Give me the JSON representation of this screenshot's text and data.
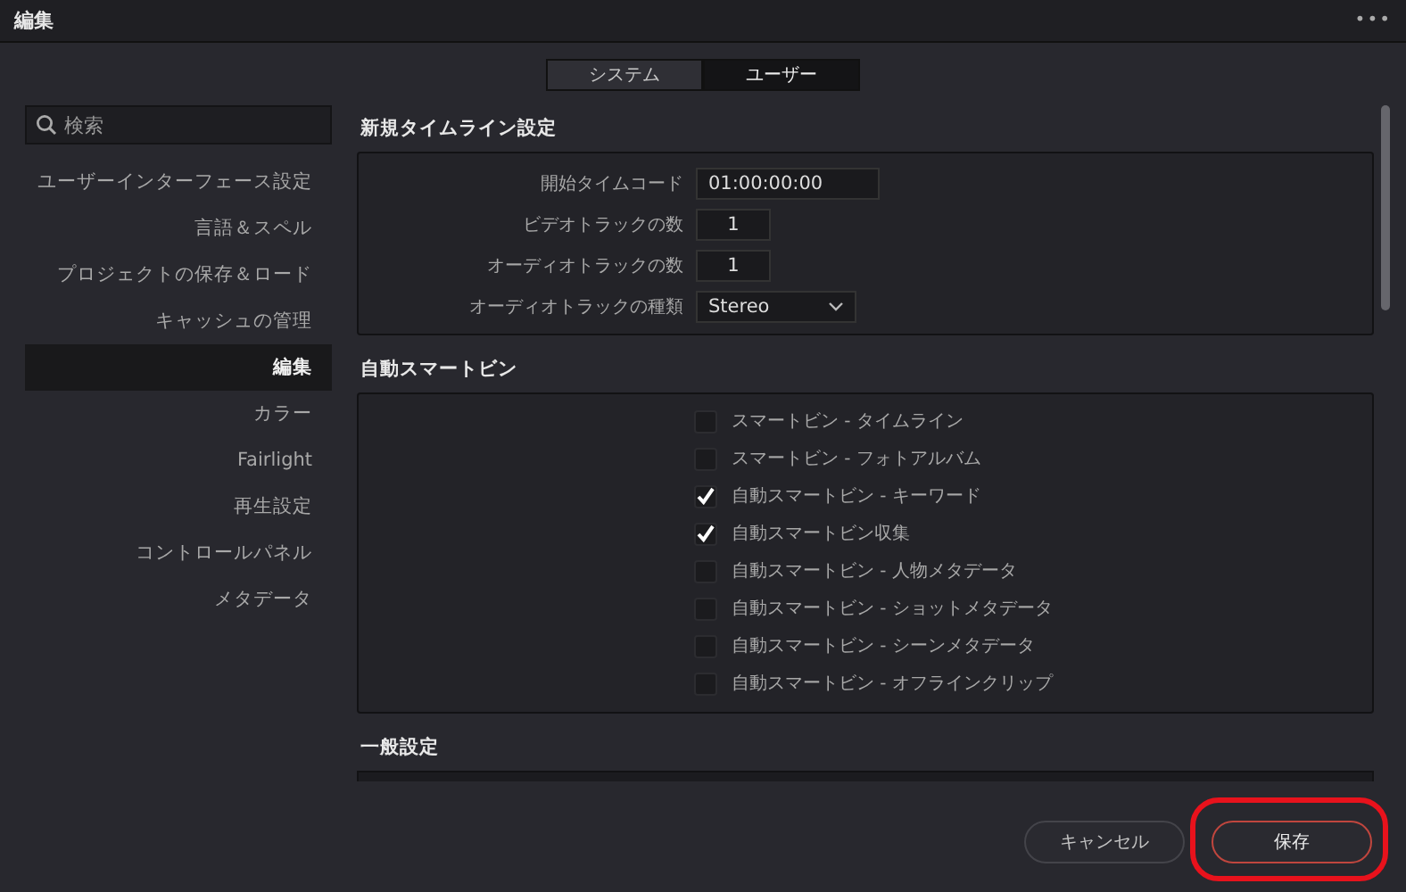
{
  "window": {
    "title": "編集",
    "menu_icon": "•••"
  },
  "tabs": [
    {
      "label": "システム",
      "selected": false
    },
    {
      "label": "ユーザー",
      "selected": true
    }
  ],
  "search": {
    "placeholder": "検索"
  },
  "sidebar": {
    "items": [
      {
        "label": "ユーザーインターフェース設定",
        "selected": false
      },
      {
        "label": "言語＆スペル",
        "selected": false
      },
      {
        "label": "プロジェクトの保存＆ロード",
        "selected": false
      },
      {
        "label": "キャッシュの管理",
        "selected": false
      },
      {
        "label": "編集",
        "selected": true
      },
      {
        "label": "カラー",
        "selected": false
      },
      {
        "label": "Fairlight",
        "selected": false
      },
      {
        "label": "再生設定",
        "selected": false
      },
      {
        "label": "コントロールパネル",
        "selected": false
      },
      {
        "label": "メタデータ",
        "selected": false
      }
    ]
  },
  "timeline_settings": {
    "title": "新規タイムライン設定",
    "fields": [
      {
        "kind": "text",
        "label": "開始タイムコード",
        "value": "01:00:00:00"
      },
      {
        "kind": "number",
        "label": "ビデオトラックの数",
        "value": "1"
      },
      {
        "kind": "number",
        "label": "オーディオトラックの数",
        "value": "1"
      },
      {
        "kind": "dropdown",
        "label": "オーディオトラックの種類",
        "value": "Stereo"
      }
    ]
  },
  "smart_bins": {
    "title": "自動スマートビン",
    "options": [
      {
        "label": "スマートビン - タイムライン",
        "checked": false
      },
      {
        "label": "スマートビン - フォトアルバム",
        "checked": false
      },
      {
        "label": "自動スマートビン - キーワード",
        "checked": true
      },
      {
        "label": "自動スマートビン収集",
        "checked": true
      },
      {
        "label": "自動スマートビン - 人物メタデータ",
        "checked": false
      },
      {
        "label": "自動スマートビン - ショットメタデータ",
        "checked": false
      },
      {
        "label": "自動スマートビン - シーンメタデータ",
        "checked": false
      },
      {
        "label": "自動スマートビン - オフラインクリップ",
        "checked": false
      }
    ]
  },
  "general_settings": {
    "title": "一般設定"
  },
  "buttons": [
    {
      "label": "キャンセル",
      "highlighted": false
    },
    {
      "label": "保存",
      "highlighted": true
    }
  ]
}
